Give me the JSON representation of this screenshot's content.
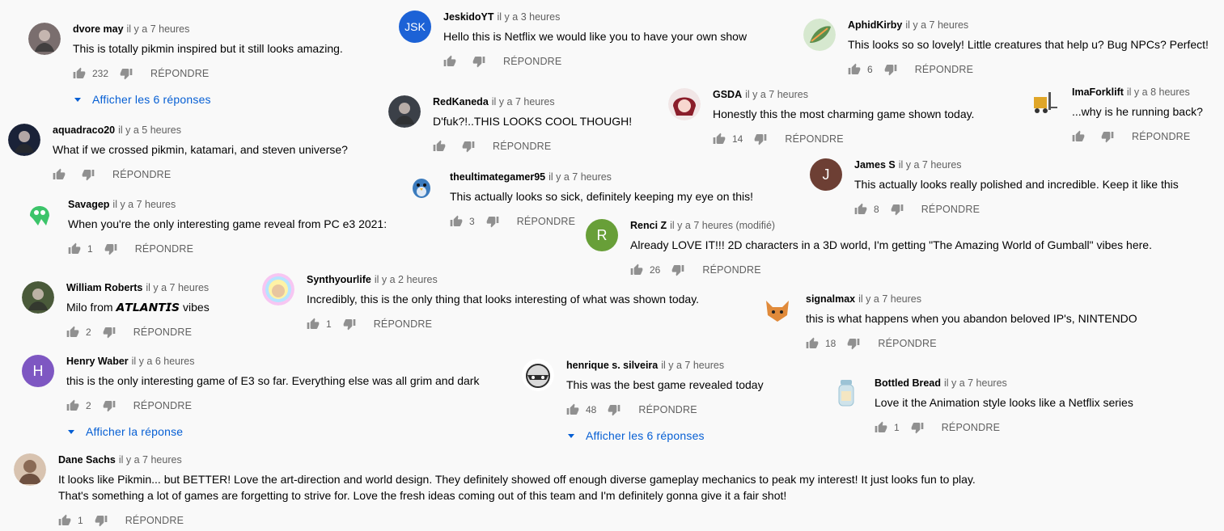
{
  "reply_label": "RÉPONDRE",
  "colors": {
    "link": "#065fd4",
    "meta": "#606060",
    "icon": "#909090"
  },
  "comments": [
    {
      "id": "c1",
      "author": "dvore may",
      "time": "il y a 7 heures",
      "text": "This is totally pikmin inspired but it still looks amazing.",
      "likes": "232",
      "avatar": {
        "type": "image",
        "icon": "character-avatar-icon",
        "color": "#7a6e6e"
      },
      "replies_link": "Afficher les 6 réponses"
    },
    {
      "id": "c2",
      "author": "JeskidoYT",
      "time": "il y a 3 heures",
      "text": "Hello this is Netflix we would like you to have your own show",
      "likes": "",
      "avatar": {
        "type": "text",
        "letter": "JSK",
        "color": "#1c62d6"
      }
    },
    {
      "id": "c3",
      "author": "AphidKirby",
      "time": "il y a 7 heures",
      "text": "This looks so so lovely! Little creatures that help u? Bug NPCs? Perfect!",
      "likes": "6",
      "avatar": {
        "type": "image",
        "icon": "leaf-avatar-icon",
        "color": "#5c8f4e"
      }
    },
    {
      "id": "c4",
      "author": "RedKaneda",
      "time": "il y a 7 heures",
      "text": "D'fuk?!..THIS LOOKS COOL THOUGH!",
      "likes": "",
      "avatar": {
        "type": "image",
        "icon": "character-avatar-icon",
        "color": "#3b4048"
      }
    },
    {
      "id": "c5",
      "author": "GSDA",
      "time": "il y a 7 heures",
      "text": "Honestly this the most charming game shown today.",
      "likes": "14",
      "avatar": {
        "type": "image",
        "icon": "anime-avatar-icon",
        "color": "#8a1d2a"
      }
    },
    {
      "id": "c6",
      "author": "ImaForklift",
      "time": "il y a 8 heures",
      "text": "...why is he running back?",
      "likes": "",
      "avatar": {
        "type": "image",
        "icon": "forklift-avatar-icon",
        "color": "#e0a628"
      }
    },
    {
      "id": "c7",
      "author": "aquadraco20",
      "time": "il y a 5 heures",
      "text": "What if we crossed pikmin, katamari, and steven universe?",
      "likes": "",
      "avatar": {
        "type": "image",
        "icon": "character-avatar-icon",
        "color": "#1a2238"
      }
    },
    {
      "id": "c8",
      "author": "James S",
      "time": "il y a 7 heures",
      "text": "This actually looks really polished and incredible. Keep it like this",
      "likes": "8",
      "avatar": {
        "type": "text",
        "letter": "J",
        "color": "#6d3f34"
      }
    },
    {
      "id": "c9",
      "author": "theultimategamer95",
      "time": "il y a 7 heures",
      "text": "This actually looks so sick, definitely keeping my eye on this!",
      "likes": "3",
      "avatar": {
        "type": "image",
        "icon": "bird-avatar-icon",
        "color": "#3b7bbd"
      }
    },
    {
      "id": "c10",
      "author": "Savagep",
      "time": "il y a 7 heures",
      "text": "When you're the only interesting game reveal from PC e3 2021:",
      "likes": "1",
      "avatar": {
        "type": "image",
        "icon": "squid-avatar-icon",
        "color": "#3cc46a"
      }
    },
    {
      "id": "c11",
      "author": "Renci Z",
      "time": "il y a 7 heures (modifié)",
      "text": "Already LOVE IT!!! 2D characters in a 3D world, I'm getting \"The Amazing World of Gumball\" vibes here.",
      "likes": "26",
      "avatar": {
        "type": "text",
        "letter": "R",
        "color": "#689f38"
      }
    },
    {
      "id": "c12",
      "author": "William Roberts",
      "time": "il y a 7 heures",
      "text": "Milo from 𝘼𝙏𝙇𝘼𝙉𝙏𝙄𝙎 vibes",
      "likes": "2",
      "avatar": {
        "type": "image",
        "icon": "character-avatar-icon",
        "color": "#4a5a3a"
      }
    },
    {
      "id": "c13",
      "author": "Synthyourlife",
      "time": "il y a 2 heures",
      "text": "Incredibly, this is the only thing that looks interesting of what was shown today.",
      "likes": "1",
      "avatar": {
        "type": "image",
        "icon": "rainbow-avatar-icon",
        "color": "#d9a6e8"
      }
    },
    {
      "id": "c14",
      "author": "signalmax",
      "time": "il y a 7 heures",
      "text": "this is what happens when you abandon beloved IP's, NINTENDO",
      "likes": "18",
      "avatar": {
        "type": "image",
        "icon": "fox-avatar-icon",
        "color": "#e08a3a"
      }
    },
    {
      "id": "c15",
      "author": "Henry Waber",
      "time": "il y a 6 heures",
      "text": "this is the only interesting game of E3 so far. Everything else was all grim and dark",
      "likes": "2",
      "avatar": {
        "type": "text",
        "letter": "H",
        "color": "#7e57c2"
      },
      "replies_link": "Afficher la réponse"
    },
    {
      "id": "c16",
      "author": "henrique s. silveira",
      "time": "il y a 7 heures",
      "text": "This was the best game revealed today",
      "likes": "48",
      "avatar": {
        "type": "image",
        "icon": "raccoon-avatar-icon",
        "color": "#2b2b2b"
      },
      "replies_link": "Afficher les 6 réponses"
    },
    {
      "id": "c17",
      "author": "Bottled Bread",
      "time": "il y a 7 heures",
      "text": "Love it the Animation style looks like a Netflix series",
      "likes": "1",
      "avatar": {
        "type": "image",
        "icon": "bottle-avatar-icon",
        "color": "#cfe3ea"
      }
    },
    {
      "id": "c18",
      "author": "Dane Sachs",
      "time": "il y a 7 heures",
      "text": "It looks like Pikmin... but BETTER! Love the art-direction and world design. They definitely showed off enough diverse gameplay mechanics to peak my interest! It just looks fun to play.",
      "text2": "That's something a lot of games are forgetting to strive for. Love the fresh ideas coming out of this team and I'm definitely gonna give it a fair shot!",
      "likes": "1",
      "avatar": {
        "type": "image",
        "icon": "person-avatar-icon",
        "color": "#8a6a55"
      }
    }
  ]
}
